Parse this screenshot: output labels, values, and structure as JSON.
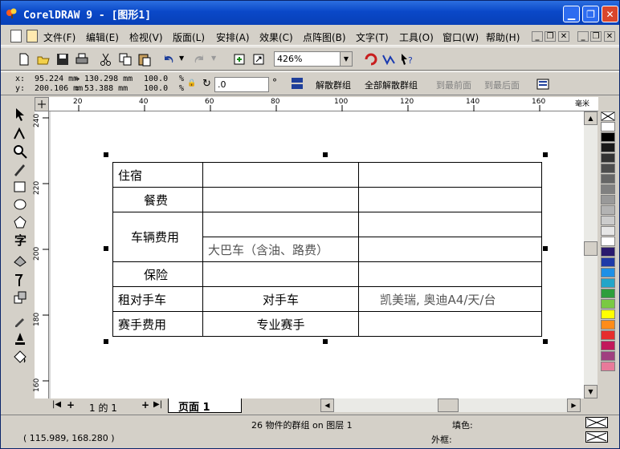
{
  "title": "CorelDRAW 9 - [图形1]",
  "menu": [
    "文件(F)",
    "编辑(E)",
    "检视(V)",
    "版面(L)",
    "安排(A)",
    "效果(C)",
    "点阵图(B)",
    "文字(T)",
    "工具(O)",
    "窗口(W)",
    "帮助(H)"
  ],
  "zoom": "426%",
  "props": {
    "x_label": "x:",
    "x_value": "95.224 mm",
    "y_label": "y:",
    "y_value": "200.106 mm",
    "w_value": "130.298 mm",
    "h_value": "53.388 mm",
    "scale_x": "100.0",
    "scale_y": "100.0",
    "pct": "%",
    "angle": ".0",
    "deg": "°",
    "btn_ungroup": "解散群组",
    "btn_ungroup_all": "全部解散群组",
    "btn_front": "到最前面",
    "btn_back": "到最后面"
  },
  "ruler_top": [
    "20",
    "40",
    "60",
    "80",
    "100",
    "120",
    "140",
    "160"
  ],
  "ruler_unit": "毫米",
  "ruler_left": [
    "240",
    "220",
    "200",
    "180",
    "160"
  ],
  "table": {
    "r1": [
      "住宿",
      "",
      ""
    ],
    "r2": [
      "餐费",
      "",
      ""
    ],
    "r3a": [
      "车辆费用",
      "",
      ""
    ],
    "r3b": [
      "",
      "大巴车（含油、路费）",
      ""
    ],
    "r4": [
      "保险",
      "",
      ""
    ],
    "r5": [
      "租对手车",
      "对手车",
      "凯美瑞, 奥迪A4/天/台"
    ],
    "r6": [
      "赛手费用",
      "专业赛手",
      ""
    ]
  },
  "pagenav": {
    "page_count": "1 的 1",
    "tab_label": "页面 1"
  },
  "status": {
    "objects": "26 物件的群组 on 图层 1",
    "fill_label": "填色:",
    "outline_label": "外框:",
    "coords": "( 115.989, 168.280 )"
  },
  "colors": {
    "titlebar": "#0a48c8",
    "palette": [
      "#ffffff",
      "#000000",
      "#1a1a1a",
      "#333333",
      "#4d4d4d",
      "#666666",
      "#808080",
      "#999999",
      "#b3b3b3",
      "#cccccc",
      "#e6e6e6",
      "#ffffff",
      "#2a1a6e",
      "#1f3aa8",
      "#1e90e6",
      "#23a5c8",
      "#2e9e3c",
      "#7ac943",
      "#ffff00",
      "#ff8c1a",
      "#e62d2d",
      "#c2185b",
      "#a04080",
      "#e87a9a"
    ]
  }
}
